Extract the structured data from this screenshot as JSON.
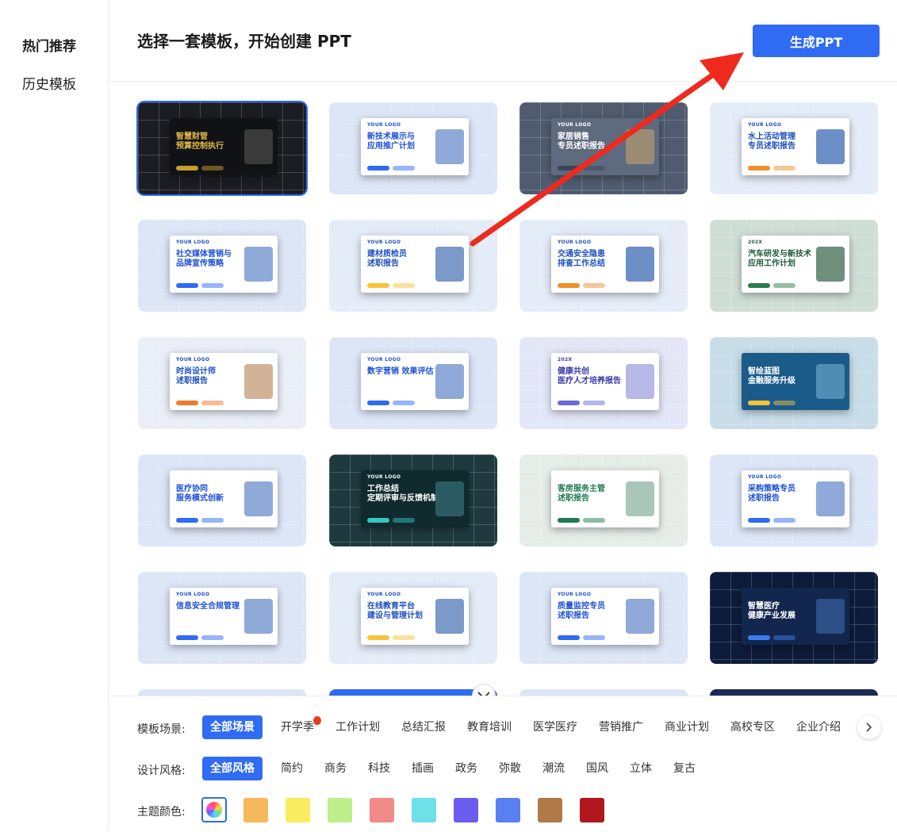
{
  "sidebar": {
    "items": [
      {
        "label": "热门推荐",
        "active": true
      },
      {
        "label": "历史模板",
        "active": false
      }
    ]
  },
  "header": {
    "title": "选择一套模板，开始创建 PPT",
    "generate_label": "生成PPT"
  },
  "templates": [
    {
      "title": "智慧财管\n预算控制执行",
      "logo": "",
      "theme": "dark-gold"
    },
    {
      "title": "新技术展示与\n应用推广计划",
      "logo": "YOUR LOGO",
      "theme": "blue"
    },
    {
      "title": "家居销售\n专员述职报告",
      "logo": "YOUR LOGO",
      "theme": "slate"
    },
    {
      "title": "水上活动管理\n专员述职报告",
      "logo": "YOUR LOGO",
      "theme": "blue-orange"
    },
    {
      "title": "社交媒体营销与\n品牌宣传策略",
      "logo": "YOUR LOGO",
      "theme": "blue"
    },
    {
      "title": "建材质检员\n述职报告",
      "logo": "YOUR LOGO",
      "theme": "blue-yellow"
    },
    {
      "title": "交通安全隐患\n排查工作总结",
      "logo": "YOUR LOGO",
      "theme": "blue-orange"
    },
    {
      "title": "汽车研发与新技术\n应用工作计划",
      "logo": "202X",
      "theme": "green"
    },
    {
      "title": "时尚设计师\n述职报告",
      "logo": "YOUR LOGO",
      "theme": "orange-blue"
    },
    {
      "title": "数字营销 效果评估",
      "logo": "YOUR LOGO",
      "theme": "blue"
    },
    {
      "title": "健康共创\n医疗人才培养报告",
      "logo": "202X",
      "theme": "purple"
    },
    {
      "title": "智绘蓝图\n金融服务升级",
      "logo": "",
      "theme": "teal"
    },
    {
      "title": "医疗协同\n服务模式创新",
      "logo": "",
      "theme": "blue"
    },
    {
      "title": "工作总结\n定期评审与反馈机制",
      "logo": "YOUR LOGO",
      "theme": "dark-teal"
    },
    {
      "title": "客房服务主管\n述职报告",
      "logo": "",
      "theme": "green-light"
    },
    {
      "title": "采购策略专员\n述职报告",
      "logo": "YOUR LOGO",
      "theme": "blue"
    },
    {
      "title": "信息安全合规管理",
      "logo": "YOUR LOGO",
      "theme": "blue"
    },
    {
      "title": "在线教育平台\n建设与管理计划",
      "logo": "YOUR LOGO",
      "theme": "blue-yellow"
    },
    {
      "title": "质量监控专员\n述职报告",
      "logo": "YOUR LOGO",
      "theme": "blue"
    },
    {
      "title": "智慧医疗\n健康产业发展",
      "logo": "",
      "theme": "navy"
    }
  ],
  "filters": {
    "scene_label": "模板场景:",
    "scenes": [
      "全部场景",
      "开学季",
      "工作计划",
      "总结汇报",
      "教育培训",
      "医学医疗",
      "营销推广",
      "商业计划",
      "高校专区",
      "企业介绍"
    ],
    "style_label": "设计风格:",
    "styles": [
      "全部风格",
      "简约",
      "商务",
      "科技",
      "插画",
      "政务",
      "弥散",
      "潮流",
      "国风",
      "立体",
      "复古"
    ],
    "color_label": "主题颜色:",
    "colors": [
      "#f5b85a",
      "#f9ec5e",
      "#bdf08a",
      "#f28a8a",
      "#6ee0e8",
      "#6b5cf0",
      "#5a7ff0",
      "#b07a48",
      "#b0161c"
    ]
  }
}
